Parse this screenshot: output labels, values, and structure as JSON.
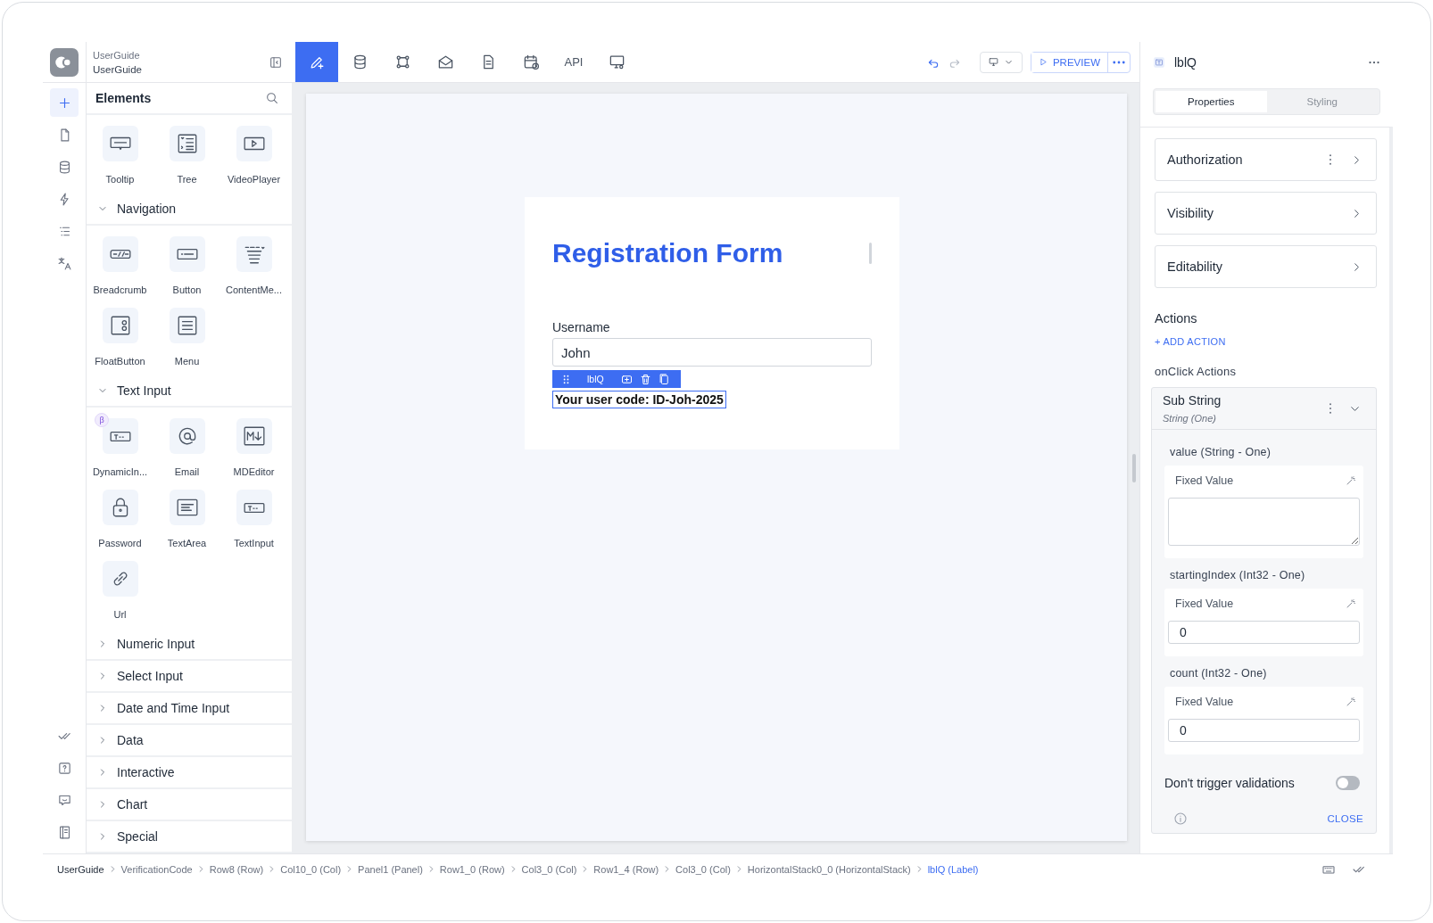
{
  "project": {
    "workspace": "UserGuide",
    "app": "UserGuide"
  },
  "rail": {
    "top": [
      {
        "kind": "plus",
        "selected": true
      },
      {
        "kind": "file",
        "selected": false
      },
      {
        "kind": "database",
        "selected": false
      },
      {
        "kind": "bolt",
        "selected": false
      },
      {
        "kind": "list",
        "selected": false
      },
      {
        "kind": "translate",
        "selected": false
      }
    ],
    "bottom": [
      {
        "kind": "checks",
        "selected": false
      },
      {
        "kind": "help",
        "selected": false
      },
      {
        "kind": "chat",
        "selected": false
      },
      {
        "kind": "book",
        "selected": false
      }
    ]
  },
  "elements": {
    "title": "Elements",
    "groups": [
      {
        "items": [
          {
            "kind": "tooltip",
            "label": "Tooltip"
          },
          {
            "kind": "tree",
            "label": "Tree"
          },
          {
            "kind": "video",
            "label": "VideoPlayer"
          }
        ]
      },
      {
        "name": "Navigation",
        "expanded": true,
        "items": [
          {
            "kind": "breadcrumb",
            "label": "Breadcrumb"
          },
          {
            "kind": "button",
            "label": "Button"
          },
          {
            "kind": "contentmenu",
            "label": "ContentMe..."
          },
          {
            "kind": "floatbutton",
            "label": "FloatButton"
          },
          {
            "kind": "menu",
            "label": "Menu"
          }
        ]
      },
      {
        "name": "Text Input",
        "expanded": true,
        "items": [
          {
            "kind": "textinput",
            "label": "DynamicIn...",
            "badge": "β"
          },
          {
            "kind": "email",
            "label": "Email"
          },
          {
            "kind": "markdown",
            "label": "MDEditor"
          },
          {
            "kind": "password",
            "label": "Password"
          },
          {
            "kind": "textarea",
            "label": "TextArea"
          },
          {
            "kind": "textinput",
            "label": "TextInput"
          },
          {
            "kind": "link",
            "label": "Url"
          }
        ]
      },
      {
        "name": "Numeric Input",
        "expanded": false
      },
      {
        "name": "Select Input",
        "expanded": false
      },
      {
        "name": "Date and Time Input",
        "expanded": false
      },
      {
        "name": "Data",
        "expanded": false
      },
      {
        "name": "Interactive",
        "expanded": false
      },
      {
        "name": "Chart",
        "expanded": false
      },
      {
        "name": "Special",
        "expanded": false
      }
    ]
  },
  "toolbar": {
    "tabs": [
      {
        "kind": "pencil",
        "selected": true
      },
      {
        "kind": "database",
        "selected": false
      },
      {
        "kind": "nodes",
        "selected": false
      },
      {
        "kind": "mail",
        "selected": false
      },
      {
        "kind": "document",
        "selected": false
      },
      {
        "kind": "calendar",
        "selected": false
      },
      {
        "kind": "text",
        "label": "API",
        "selected": false
      },
      {
        "kind": "monitor",
        "selected": false
      }
    ],
    "preview": "PREVIEW"
  },
  "canvas": {
    "form_title": "Registration Form",
    "field_label": "Username",
    "field_value": "John",
    "selection_label": "lblQ",
    "selected_text": "Your user code: ID-Joh-2025"
  },
  "inspector": {
    "title": "lblQ",
    "tabs": [
      {
        "label": "Properties",
        "selected": true
      },
      {
        "label": "Styling",
        "selected": false
      }
    ],
    "sections": [
      {
        "title": "Authorization",
        "menu": true
      },
      {
        "title": "Visibility",
        "menu": false
      },
      {
        "title": "Editability",
        "menu": false
      }
    ],
    "actions_heading": "Actions",
    "add_action": "+ ADD ACTION",
    "event_heading": "onClick Actions",
    "action": {
      "title": "Sub String",
      "subtitle": "String (One)",
      "expanded": true,
      "params": [
        {
          "label": "value (String - One)",
          "field_label": "Fixed Value",
          "kind": "textarea"
        },
        {
          "label": "startingIndex (Int32 - One)",
          "field_label": "Fixed Value",
          "kind": "input",
          "value": "0"
        },
        {
          "label": "count (Int32 - One)",
          "field_label": "Fixed Value",
          "kind": "input",
          "value": "0"
        }
      ],
      "toggle": {
        "label": "Don't trigger validations",
        "on": false
      },
      "close": "CLOSE"
    }
  },
  "breadcrumb": [
    {
      "label": "UserGuide",
      "selected": false
    },
    {
      "label": "VerificationCode",
      "selected": false
    },
    {
      "label": "Row8 (Row)",
      "selected": false
    },
    {
      "label": "Col10_0 (Col)",
      "selected": false
    },
    {
      "label": "Panel1 (Panel)",
      "selected": false
    },
    {
      "label": "Row1_0 (Row)",
      "selected": false
    },
    {
      "label": "Col3_0 (Col)",
      "selected": false
    },
    {
      "label": "Row1_4 (Row)",
      "selected": false
    },
    {
      "label": "Col3_0 (Col)",
      "selected": false
    },
    {
      "label": "HorizontalStack0_0 (HorizontalStack)",
      "selected": false
    },
    {
      "label": "lblQ (Label)",
      "selected": true
    }
  ]
}
